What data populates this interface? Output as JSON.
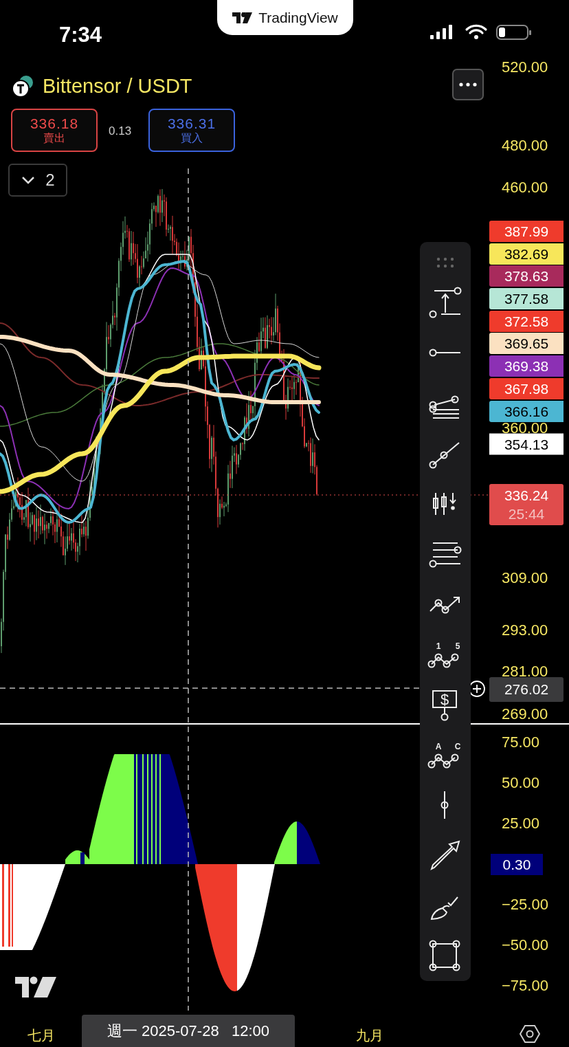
{
  "status_bar": {
    "time": "7:34"
  },
  "brand_tab": {
    "title": "TradingView"
  },
  "symbol": {
    "title": "Bittensor / USDT"
  },
  "quote": {
    "sell": {
      "price": "336.18",
      "label": "賣出"
    },
    "spread": "0.13",
    "buy": {
      "price": "336.31",
      "label": "買入"
    }
  },
  "indicator_toggle": {
    "count": "2"
  },
  "price_axis": {
    "ticks": [
      "520.00",
      "480.00",
      "460.00",
      "360.00",
      "309.00",
      "293.00",
      "281.00",
      "269.00"
    ]
  },
  "ma_labels": [
    {
      "value": "387.99",
      "color": "#ef3b2c"
    },
    {
      "value": "382.69",
      "color": "#f7e65a"
    },
    {
      "value": "378.63",
      "color": "#a82a5c"
    },
    {
      "value": "377.58",
      "color": "#b6e6d6"
    },
    {
      "value": "372.58",
      "color": "#ef3b2c"
    },
    {
      "value": "369.65",
      "color": "#fbe1c1"
    },
    {
      "value": "369.38",
      "color": "#8c30b4"
    },
    {
      "value": "367.98",
      "color": "#ef3b2c"
    },
    {
      "value": "366.16",
      "color": "#4cb6d2"
    }
  ],
  "reference_label": {
    "value": "354.13"
  },
  "current_price": {
    "value": "336.24",
    "countdown": "25:44"
  },
  "crosshair_price": "276.02",
  "oscillator_axis": {
    "ticks": [
      "75.00",
      "50.00",
      "25.00",
      "−25.00",
      "−50.00",
      "−75.00"
    ],
    "current": "0.30"
  },
  "time_axis": {
    "labels": [
      "七月",
      "九月"
    ],
    "crosshair": "週一 2025-07-28   12:00"
  },
  "drawing_tools": [
    {
      "kind": "range"
    },
    {
      "kind": "ray"
    },
    {
      "kind": "fork"
    },
    {
      "kind": "trend"
    },
    {
      "kind": "bars"
    },
    {
      "kind": "channel"
    },
    {
      "kind": "path"
    },
    {
      "kind": "pattern",
      "glyphs": [
        "1",
        "5"
      ]
    },
    {
      "kind": "price",
      "glyphs": [
        "$"
      ]
    },
    {
      "kind": "pattern",
      "glyphs": [
        "A",
        "C"
      ]
    },
    {
      "kind": "vline"
    },
    {
      "kind": "arrow"
    },
    {
      "kind": "brush"
    },
    {
      "kind": "rect"
    }
  ]
}
